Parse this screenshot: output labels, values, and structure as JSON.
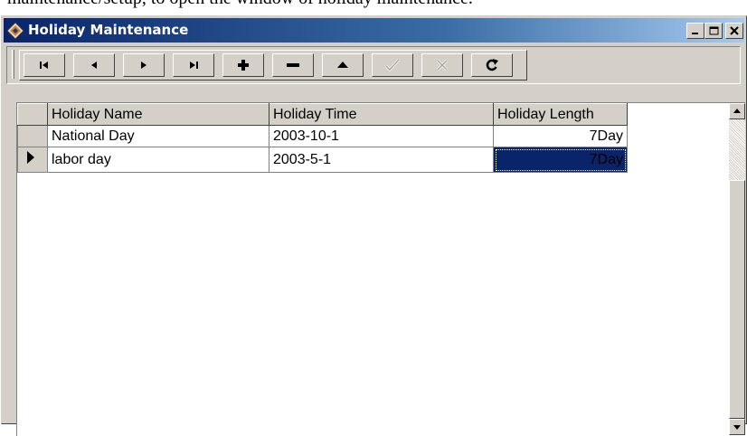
{
  "document": {
    "caption": "maintenance/setup, to open the window of holiday maintenance."
  },
  "window": {
    "title": "Holiday Maintenance",
    "controls": [
      "minimize-icon",
      "maximize-icon",
      "close-icon"
    ]
  },
  "navigator": {
    "buttons": [
      {
        "name": "first-record",
        "icon": "first-record-icon"
      },
      {
        "name": "prior-record",
        "icon": "prior-arrow-icon"
      },
      {
        "name": "next-record",
        "icon": "next-arrow-icon"
      },
      {
        "name": "last-record",
        "icon": "last-record-icon"
      },
      {
        "name": "insert-record",
        "icon": "plus-icon"
      },
      {
        "name": "delete-record",
        "icon": "minus-icon"
      },
      {
        "name": "edit-record",
        "icon": "up-triangle-icon"
      },
      {
        "name": "post-edit",
        "icon": "check-icon",
        "enabled": false
      },
      {
        "name": "cancel-edit",
        "icon": "x-icon",
        "enabled": false
      },
      {
        "name": "refresh-data",
        "icon": "refresh-icon"
      }
    ]
  },
  "grid": {
    "columns": [
      "Holiday Name",
      "Holiday Time",
      "Holiday Length"
    ],
    "rows": [
      {
        "name": "National Day",
        "time": "2003-10-1",
        "length": "7Day",
        "current": false
      },
      {
        "name": "labor day",
        "time": "2003-5-1",
        "length": "7Day",
        "current": true
      }
    ]
  },
  "colors": {
    "title_active": "#0a246a",
    "title_gradient_end": "#a6caf0",
    "face": "#d4d0c8",
    "selection": "#0a246a"
  }
}
